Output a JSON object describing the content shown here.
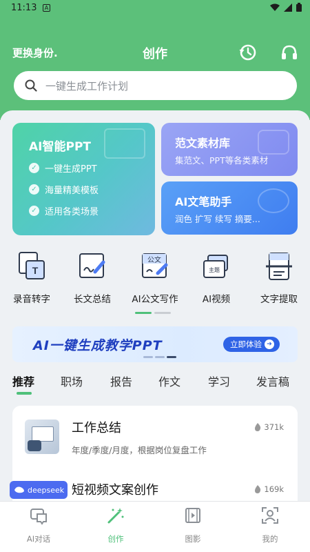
{
  "status_bar": {
    "time": "11:13",
    "notice_icon": "A"
  },
  "header": {
    "switch_identity": "更换身份.",
    "title": "创作",
    "history_icon": "history-icon",
    "support_icon": "headset-icon"
  },
  "search": {
    "placeholder": "一键生成工作计划"
  },
  "feature_cards": {
    "ppt": {
      "title": "AI智能PPT",
      "features": [
        "一键生成PPT",
        "海量精美模板",
        "适用各类场景"
      ]
    },
    "fanwen": {
      "title": "范文素材库",
      "subtitle": "集范文、PPT等各类素材"
    },
    "writer": {
      "title": "AI文笔助手",
      "subtitle": "润色 扩写 续写 摘要..."
    }
  },
  "tools": [
    {
      "label": "录音转字",
      "icon": "transcribe-icon"
    },
    {
      "label": "长文总结",
      "icon": "long-summary-icon"
    },
    {
      "label": "AI公文写作",
      "icon": "official-doc-icon"
    },
    {
      "label": "AI视频",
      "icon": "video-icon"
    },
    {
      "label": "文字提取",
      "icon": "text-extract-icon"
    }
  ],
  "banner": {
    "text": "AI一键生成教学PPT",
    "button": "立即体验"
  },
  "category_tabs": [
    "推荐",
    "职场",
    "报告",
    "作文",
    "学习",
    "发言稿"
  ],
  "list_items": [
    {
      "title": "工作总结",
      "desc": "年度/季度/月度，根据岗位复盘工作",
      "count": "371k"
    },
    {
      "title": "短视频文案创作",
      "count": "169k"
    }
  ],
  "deepseek_badge": "deepseek",
  "bottom_nav": [
    {
      "label": "AI对话",
      "icon": "chat-icon"
    },
    {
      "label": "创作",
      "icon": "magic-wand-icon"
    },
    {
      "label": "图影",
      "icon": "film-icon"
    },
    {
      "label": "我的",
      "icon": "profile-icon"
    }
  ],
  "colors": {
    "brand_green": "#5cc07a",
    "accent_green": "#4fc07a",
    "banner_blue": "#2f63e6"
  }
}
